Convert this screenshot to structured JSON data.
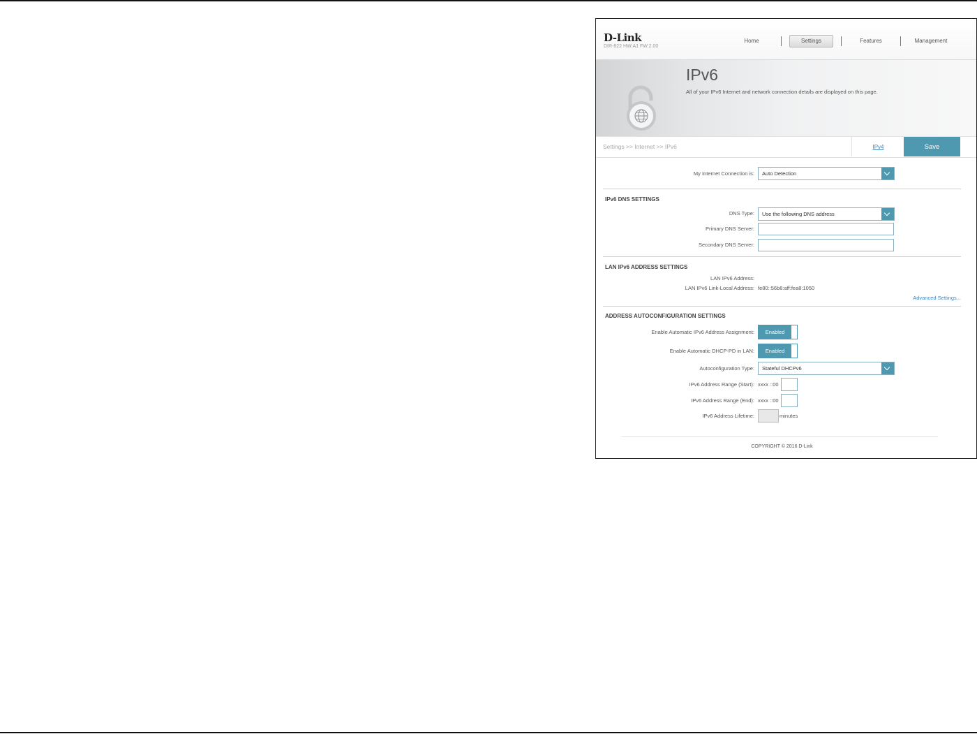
{
  "header": {
    "logo": "D-Link",
    "model": "DIR-822 HW:A1 FW:2.00",
    "nav": [
      {
        "label": "Home",
        "active": false
      },
      {
        "label": "Settings",
        "active": true
      },
      {
        "label": "Features",
        "active": false
      },
      {
        "label": "Management",
        "active": false
      }
    ]
  },
  "banner": {
    "title": "IPv6",
    "description": "All of your IPv6 Internet and network connection details are displayed on this page.",
    "icon": "lock-globe-icon"
  },
  "breadcrumb": "Settings >> Internet >> IPv6",
  "actions": {
    "ipv4_link": "IPv4",
    "save_label": "Save"
  },
  "connection": {
    "label": "My Internet Connection is:",
    "value": "Auto Detection"
  },
  "dns": {
    "section": "IPv6 DNS SETTINGS",
    "type_label": "DNS Type:",
    "type_value": "Use the following DNS address",
    "primary_label": "Primary DNS Server:",
    "primary_value": "",
    "secondary_label": "Secondary DNS Server:",
    "secondary_value": ""
  },
  "lan": {
    "section": "LAN IPv6 ADDRESS SETTINGS",
    "address_label": "LAN IPv6 Address:",
    "address_value": "",
    "linklocal_label": "LAN IPv6 Link-Local Address:",
    "linklocal_value": "fe80::56b8:aff:fea8:1050",
    "advanced": "Advanced Settings..."
  },
  "autoconf": {
    "section": "ADDRESS AUTOCONFIGURATION SETTINGS",
    "auto_assign_label": "Enable Automatic IPv6 Address Assignment:",
    "auto_assign_value": "Enabled",
    "dhcp_pd_label": "Enable Automatic DHCP-PD in LAN:",
    "dhcp_pd_value": "Enabled",
    "type_label": "Autoconfiguration Type:",
    "type_value": "Stateful DHCPv6",
    "range_start_label": "IPv6 Address Range (Start):",
    "range_start_prefix": "xxxx ::00",
    "range_end_label": "IPv6 Address Range (End):",
    "range_end_prefix": "xxxx ::00",
    "lifetime_label": "IPv6 Address Lifetime:",
    "lifetime_unit": "minutes"
  },
  "footer": {
    "copyright": "COPYRIGHT © 2016 D-Link"
  },
  "colors": {
    "accent": "#4e99b0",
    "link": "#3a87c0"
  }
}
